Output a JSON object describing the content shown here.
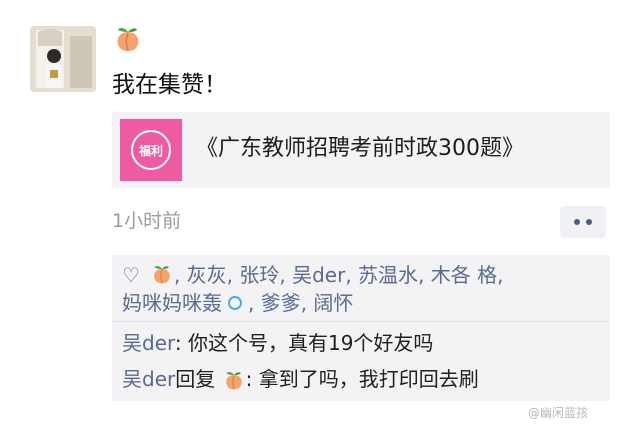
{
  "post": {
    "text": "我在集赞！",
    "link_title": "《广东教师招聘考前时政300题》",
    "link_thumb_text": "福利",
    "timestamp": "1小时前"
  },
  "likes": {
    "names_row1": [
      ", 灰灰",
      ", 张玲",
      ", 吴der",
      ", 苏温水",
      ", 木各 格,"
    ],
    "names_row2_a": "妈咪妈咪轰",
    "names_row2_b": [
      ", 爹爹",
      ", 阔怀"
    ]
  },
  "comments": [
    {
      "name": "吴der",
      "separator": ": ",
      "text": "你这个号，真有19个好友吗"
    },
    {
      "name": "吴der",
      "reply_word": "回复",
      "separator": ": ",
      "text": "拿到了吗，我打印回去刷"
    }
  ],
  "watermark": "@幽闲蓝孩",
  "colors": {
    "name_blue": "#5b6a91",
    "card_bg": "#f3f3f5",
    "thumb_pink": "#ee5ba0",
    "peach": "#f4a36a"
  }
}
